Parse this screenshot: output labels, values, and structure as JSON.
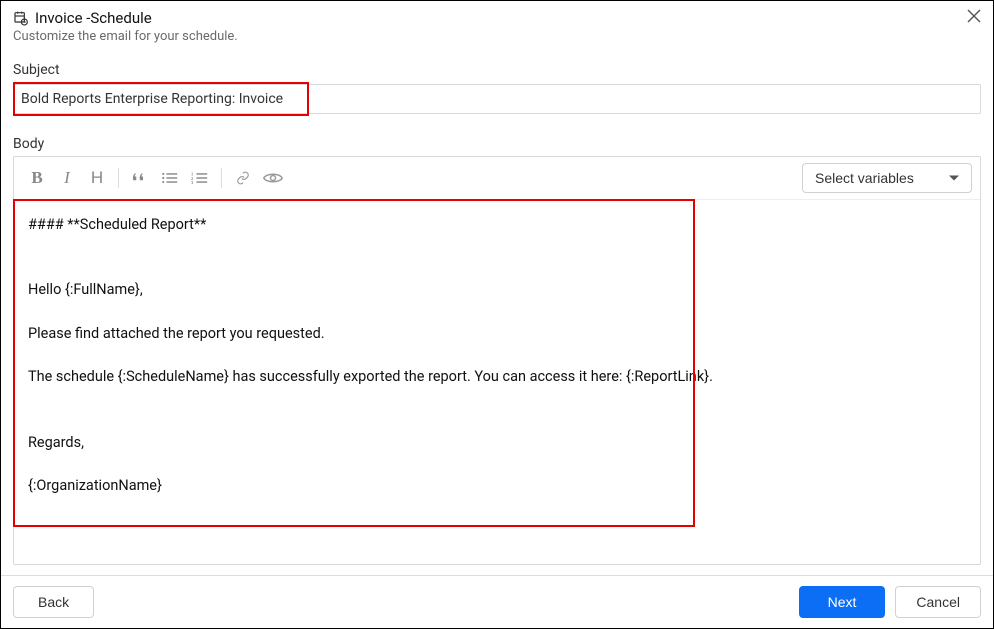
{
  "header": {
    "title": "Invoice -Schedule",
    "subtitle": "Customize the email for your schedule."
  },
  "subject": {
    "label": "Subject",
    "value": "Bold Reports Enterprise Reporting: Invoice"
  },
  "body": {
    "label": "Body",
    "content": "#### **Scheduled Report**\n\n\nHello {:FullName},\n\nPlease find attached the report you requested.\n\nThe schedule {:ScheduleName} has successfully exported the report. You can access it here: {:ReportLink}.\n\n\nRegards,\n\n{:OrganizationName}"
  },
  "toolbar": {
    "select_variables_label": "Select variables"
  },
  "footer": {
    "back": "Back",
    "next": "Next",
    "cancel": "Cancel"
  }
}
